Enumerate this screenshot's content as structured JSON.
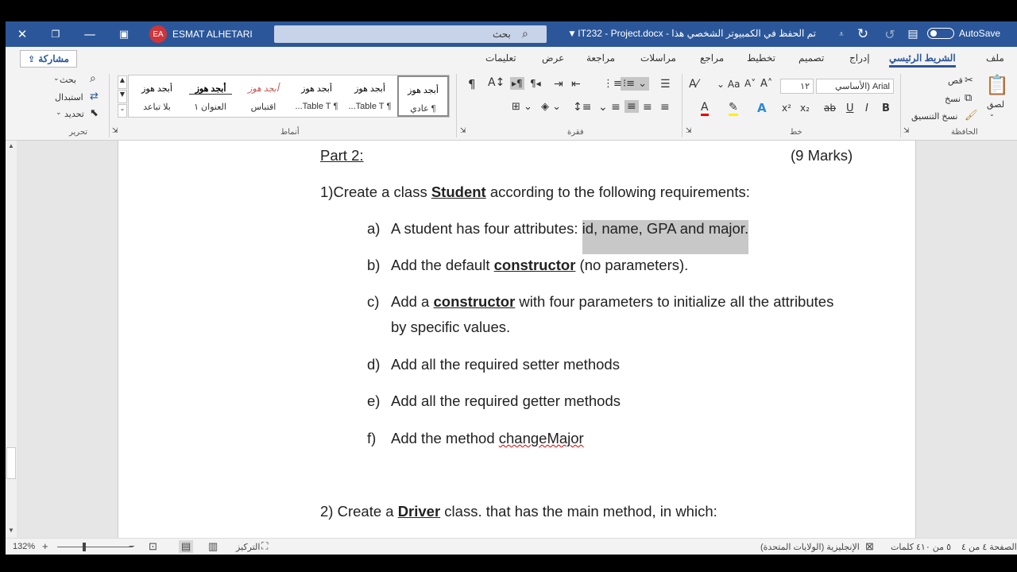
{
  "titlebar": {
    "user_initials": "EA",
    "user_name": "ESMAT ALHETARI",
    "search_placeholder": "بحث",
    "document_title": "IT232 - Project.docx - تم الحفظ في الكمبيوتر الشخصي هذا",
    "autosave_label": "AutoSave"
  },
  "menu": {
    "tabs": [
      "ملف",
      "الشريط الرئيسي",
      "إدراج",
      "تصميم",
      "تخطيط",
      "مراجع",
      "مراسلات",
      "مراجعة",
      "عرض",
      "تعليمات"
    ],
    "active_tab": "الشريط الرئيسي",
    "share_label": "مشاركة"
  },
  "ribbon": {
    "clipboard": {
      "paste": "لصق",
      "cut": "قص",
      "copy": "نسخ",
      "format_painter": "نسخ التنسيق",
      "group": "الحافظة"
    },
    "font": {
      "name": "Arial (الأساسي",
      "size": "١٢",
      "group": "خط"
    },
    "paragraph": {
      "group": "فقرة"
    },
    "styles": {
      "items": [
        {
          "preview": "أبجد هوز",
          "name": "¶ عادي"
        },
        {
          "preview": "أبجد هوز",
          "name": "¶ Table T..."
        },
        {
          "preview": "أبجد هوز",
          "name": "¶ Table T..."
        },
        {
          "preview": "أبجد هوز",
          "name": "اقتباس"
        },
        {
          "preview": "أبجد هوز",
          "name": "العنوان ١"
        },
        {
          "preview": "أبجد هوز",
          "name": "بلا تباعد"
        }
      ],
      "group": "أنماط"
    },
    "editing": {
      "find": "بحث",
      "replace": "استبدال",
      "select": "تحديد",
      "group": "تحرير"
    }
  },
  "document": {
    "part_heading": "Part 2:",
    "marks": "(9 Marks)",
    "q1_prefix": "1)Create a class ",
    "q1_class": "Student",
    "q1_suffix": " according to the following requirements:",
    "items": [
      {
        "label": "a)",
        "text_before": "A student has four attributes: ",
        "highlight": "id, name, GPA and major."
      },
      {
        "label": "b)",
        "text_before": "Add the default ",
        "bold": "constructor",
        "text_after": " (no parameters)."
      },
      {
        "label": "c)",
        "text_before": "Add a ",
        "bold": "constructor",
        "text_after": " with four parameters to initialize all the attributes",
        "line2": "by specific values."
      },
      {
        "label": "d)",
        "text": "Add all the required setter methods"
      },
      {
        "label": "e)",
        "text": "Add all the required getter methods"
      },
      {
        "label": "f)",
        "text_before": "Add the method ",
        "squiggle": "changeMajor"
      }
    ],
    "q2_prefix": "2)  Create a ",
    "q2_class": "Driver",
    "q2_suffix": " class. that has the main method, in which:"
  },
  "status": {
    "zoom": "132%",
    "focus": "التركيز",
    "language": "الإنجليزية (الولايات المتحدة)",
    "words": "٥ من ٤١٠ كلمات",
    "page": "الصفحة ٤ من ٤"
  }
}
